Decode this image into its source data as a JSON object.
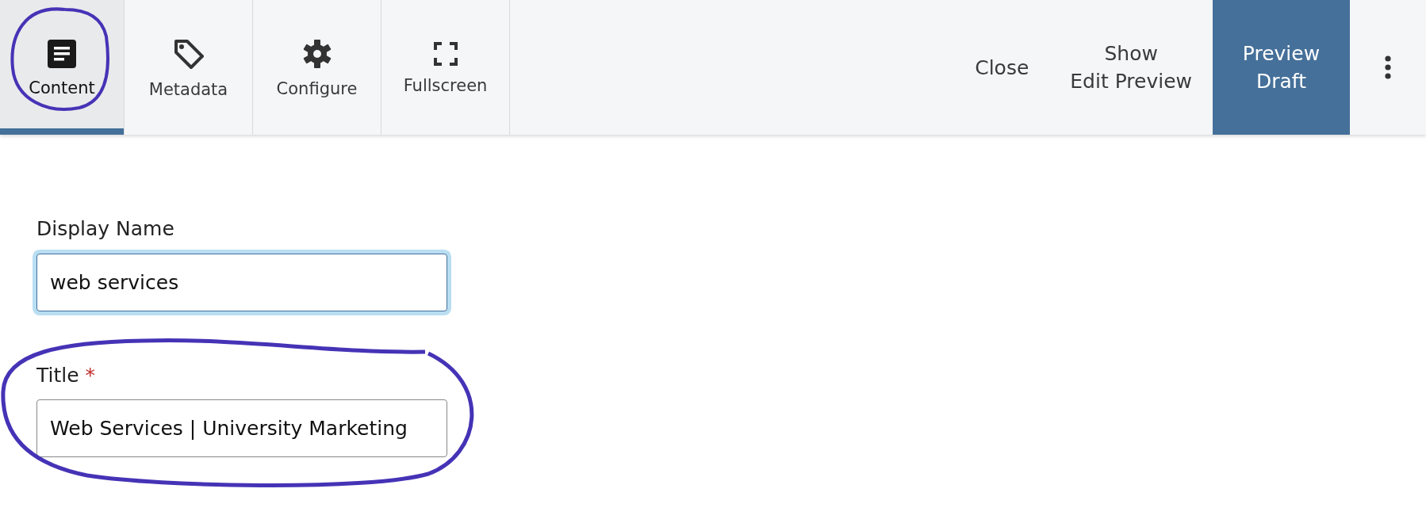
{
  "toolbar": {
    "tabs": [
      {
        "label": "Content",
        "selected": true
      },
      {
        "label": "Metadata",
        "selected": false
      },
      {
        "label": "Configure",
        "selected": false
      },
      {
        "label": "Fullscreen",
        "selected": false
      }
    ],
    "actions": [
      {
        "label": "Close",
        "kind": "plain"
      },
      {
        "label": "Show\nEdit Preview",
        "kind": "plain"
      },
      {
        "label": "Preview\nDraft",
        "kind": "primary"
      }
    ]
  },
  "form": {
    "fields": [
      {
        "label": "Display Name",
        "value": "web services",
        "focused": true
      },
      {
        "label": "Title",
        "required_mark": "*",
        "value": "Web Services | University Marketing",
        "focused": false
      }
    ]
  }
}
